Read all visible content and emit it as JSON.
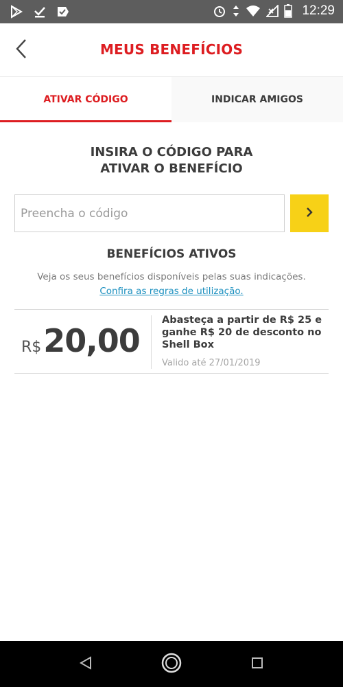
{
  "status_bar": {
    "time": "12:29",
    "icons": [
      "play-store-icon",
      "download-check-icon",
      "checkmark-app-icon",
      "alarm-icon",
      "data-arrows-icon",
      "wifi-icon",
      "signal-icon",
      "battery-icon"
    ]
  },
  "header": {
    "title": "MEUS BENEFÍCIOS",
    "back_icon": "chevron-left-icon"
  },
  "tabs": [
    {
      "label": "ATIVAR CÓDIGO",
      "active": true
    },
    {
      "label": "INDICAR AMIGOS",
      "active": false
    }
  ],
  "activation": {
    "heading_line1": "INSIRA O CÓDIGO PARA",
    "heading_line2": "ATIVAR O BENEFÍCIO",
    "input_placeholder": "Preencha o código",
    "input_value": "",
    "submit_icon": "chevron-right-icon"
  },
  "benefits": {
    "heading": "BENEFÍCIOS ATIVOS",
    "description": "Veja os seus benefícios disponíveis pelas suas indicações.",
    "rules_link": "Confira as regras de utilização.",
    "items": [
      {
        "currency": "R$",
        "value": "20,00",
        "text": "Abasteça a partir de R$ 25 e ganhe R$ 20 de desconto no Shell Box",
        "valid_until": "Valido até 27/01/2019"
      }
    ]
  },
  "nav_bar": {
    "icons": [
      "back-triangle-icon",
      "home-circle-icon",
      "recents-square-icon"
    ]
  },
  "colors": {
    "brand_red": "#dd1d21",
    "brand_yellow": "#f7d117",
    "link_blue": "#1a8fbf"
  }
}
